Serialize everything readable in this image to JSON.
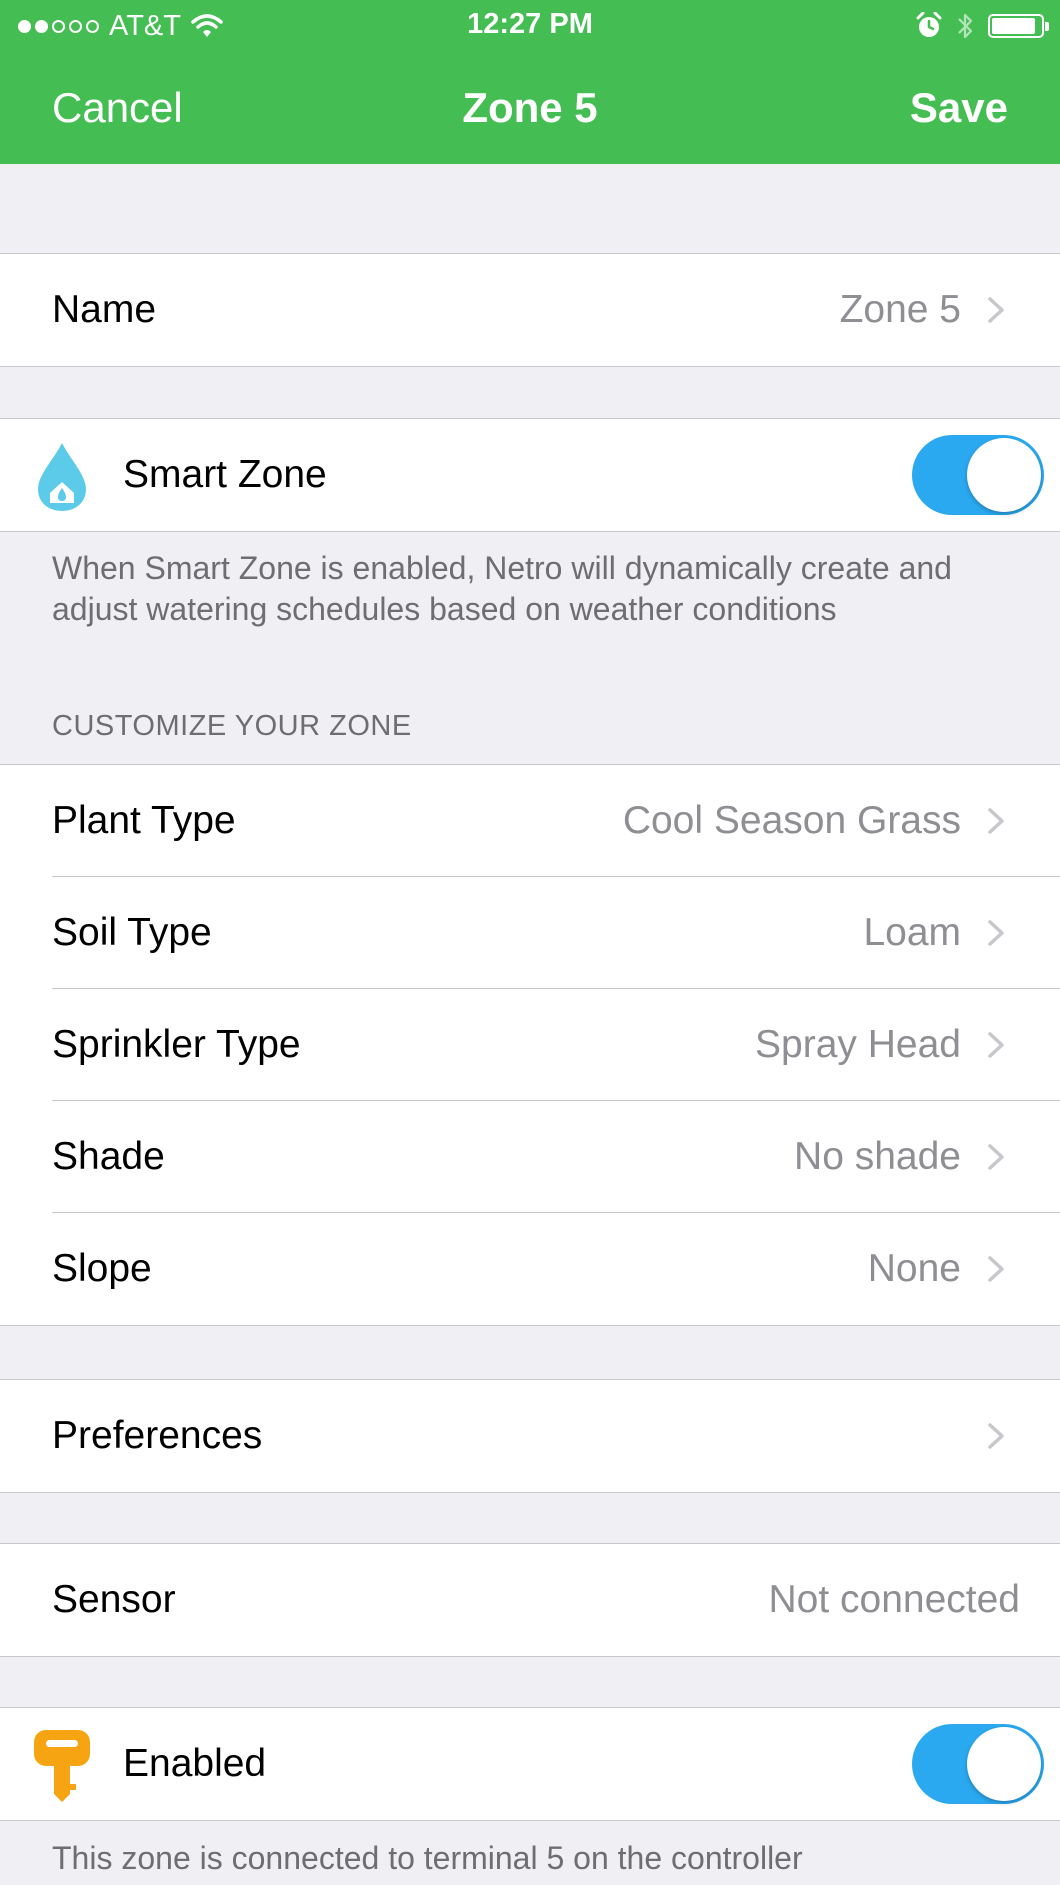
{
  "status_bar": {
    "carrier": "AT&T",
    "time": "12:27 PM",
    "signal_bars": 2,
    "signal_total": 5,
    "battery_level": 0.9
  },
  "nav": {
    "cancel_label": "Cancel",
    "title": "Zone 5",
    "save_label": "Save"
  },
  "name_row": {
    "label": "Name",
    "value": "Zone 5"
  },
  "smart_zone": {
    "label": "Smart Zone",
    "enabled": true,
    "icon": "water-drop-icon",
    "description": "When Smart Zone is enabled, Netro will dynamically create and adjust watering schedules based on weather conditions"
  },
  "customize": {
    "header": "CUSTOMIZE YOUR ZONE",
    "items": [
      {
        "label": "Plant Type",
        "value": "Cool Season Grass"
      },
      {
        "label": "Soil Type",
        "value": "Loam"
      },
      {
        "label": "Sprinkler Type",
        "value": "Spray Head"
      },
      {
        "label": "Shade",
        "value": "No shade"
      },
      {
        "label": "Slope",
        "value": "None"
      }
    ]
  },
  "preferences": {
    "label": "Preferences"
  },
  "sensor": {
    "label": "Sensor",
    "value": "Not connected"
  },
  "enabled_row": {
    "label": "Enabled",
    "enabled": true,
    "icon": "key-icon",
    "note": "This zone is connected to terminal 5 on the controller"
  },
  "colors": {
    "nav_bar": "#44bd53",
    "toggle_on": "#2aa9f0",
    "drop_icon": "#5ccbea",
    "key_icon": "#f7a413",
    "background": "#efeff4"
  }
}
